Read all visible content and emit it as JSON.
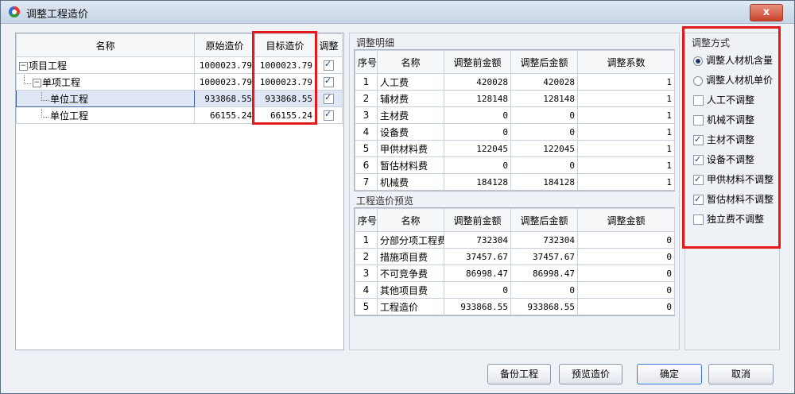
{
  "window": {
    "title": "调整工程造价",
    "close_label": "x"
  },
  "tree_table": {
    "headers": [
      "名称",
      "原始造价",
      "目标造价",
      "调整"
    ],
    "rows": [
      {
        "name": "项目工程",
        "original": "1000023.79",
        "target": "1000023.79",
        "adjust": true,
        "level": 0,
        "expander": "−"
      },
      {
        "name": "单项工程",
        "original": "1000023.79",
        "target": "1000023.79",
        "adjust": true,
        "level": 1,
        "expander": "−"
      },
      {
        "name": "单位工程",
        "original": "933868.55",
        "target": "933868.55",
        "adjust": true,
        "level": 2,
        "selected": true
      },
      {
        "name": "单位工程",
        "original": "66155.24",
        "target": "66155.24",
        "adjust": true,
        "level": 2
      }
    ]
  },
  "detail": {
    "group_title": "调整明细",
    "headers": [
      "序号",
      "名称",
      "调整前金额",
      "调整后金额",
      "调整系数"
    ],
    "rows": [
      [
        "1",
        "人工费",
        "420028",
        "420028",
        "1"
      ],
      [
        "2",
        "辅材费",
        "128148",
        "128148",
        "1"
      ],
      [
        "3",
        "主材费",
        "0",
        "0",
        "1"
      ],
      [
        "4",
        "设备费",
        "0",
        "0",
        "1"
      ],
      [
        "5",
        "甲供材料费",
        "122045",
        "122045",
        "1"
      ],
      [
        "6",
        "暂估材料费",
        "0",
        "0",
        "1"
      ],
      [
        "7",
        "机械费",
        "184128",
        "184128",
        "1"
      ]
    ]
  },
  "preview": {
    "group_title": "工程造价预览",
    "headers": [
      "序号",
      "名称",
      "调整前金额",
      "调整后金额",
      "调整金额"
    ],
    "rows": [
      [
        "1",
        "分部分项工程费",
        "732304",
        "732304",
        "0"
      ],
      [
        "2",
        "措施项目费",
        "37457.67",
        "37457.67",
        "0"
      ],
      [
        "3",
        "不可竞争费",
        "86998.47",
        "86998.47",
        "0"
      ],
      [
        "4",
        "其他项目费",
        "0",
        "0",
        "0"
      ],
      [
        "5",
        "工程造价",
        "933868.55",
        "933868.55",
        "0"
      ]
    ]
  },
  "method": {
    "group_title": "调整方式",
    "radios": [
      {
        "label": "调整人材机含量",
        "checked": true
      },
      {
        "label": "调整人材机单价",
        "checked": false
      }
    ],
    "checks": [
      {
        "label": "人工不调整",
        "checked": false
      },
      {
        "label": "机械不调整",
        "checked": false
      },
      {
        "label": "主材不调整",
        "checked": true
      },
      {
        "label": "设备不调整",
        "checked": true
      },
      {
        "label": "甲供材料不调整",
        "checked": true
      },
      {
        "label": "暂估材料不调整",
        "checked": true
      },
      {
        "label": "独立费不调整",
        "checked": false
      }
    ]
  },
  "buttons": {
    "backup": "备份工程",
    "preview": "预览造价",
    "ok": "确定",
    "cancel": "取消"
  },
  "colors": {
    "highlight": "#e4191b",
    "selection": "#dfe7f5"
  }
}
